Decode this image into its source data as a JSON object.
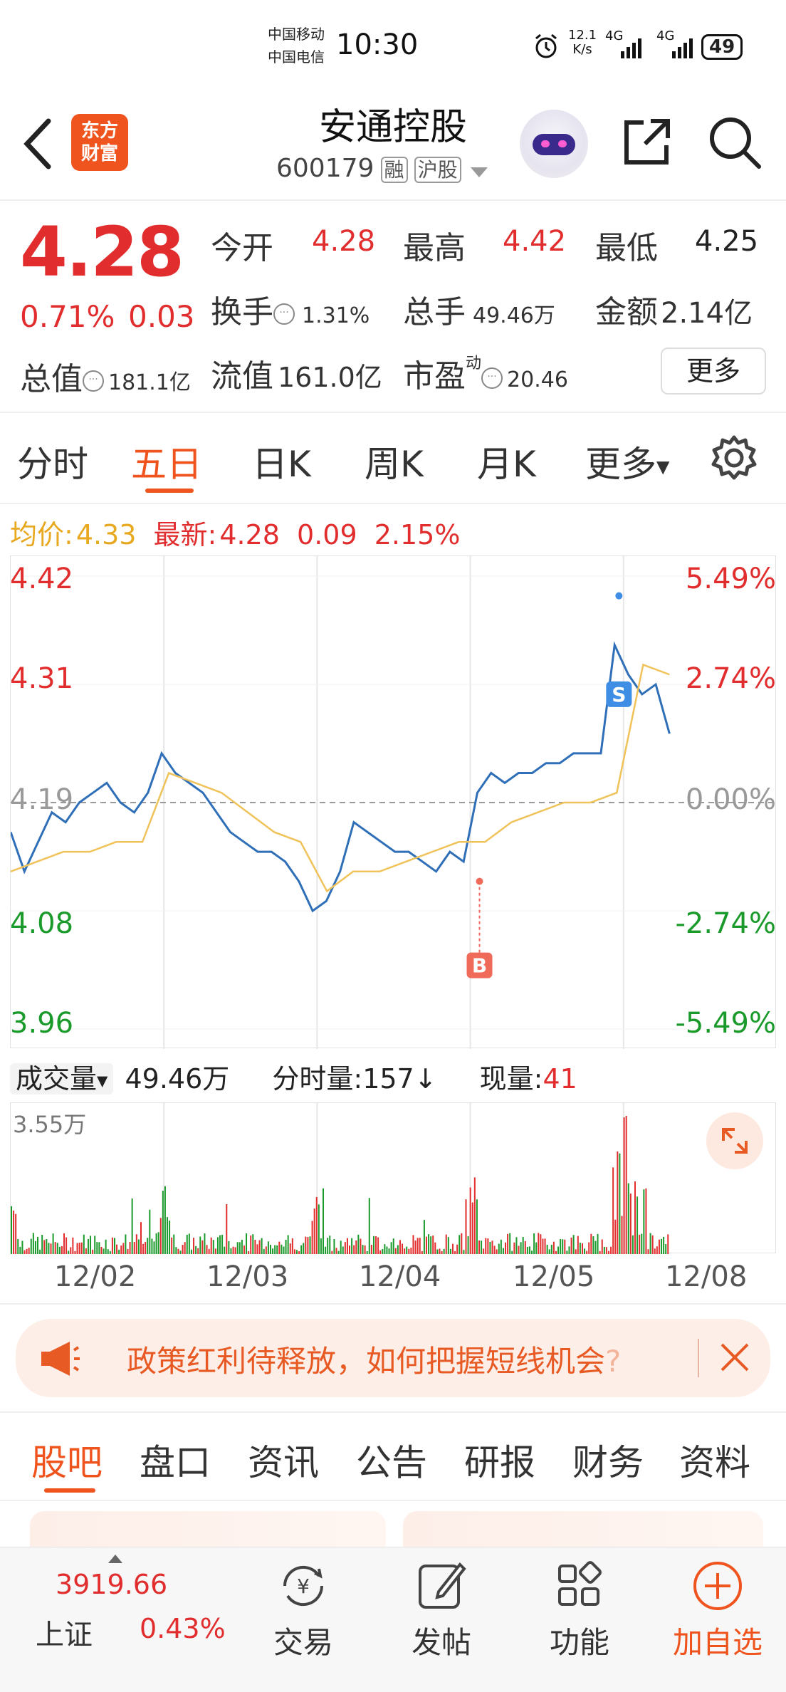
{
  "status_bar": {
    "carrier1": "中国移动",
    "carrier2": "中国电信",
    "time": "10:30",
    "net_speed_top": "12.1",
    "net_speed_unit": "K/s",
    "sig1": "4G",
    "sig2": "4G",
    "battery": "49"
  },
  "header": {
    "logo_line1": "东方",
    "logo_line2": "财富",
    "stock_name": "安通控股",
    "stock_code": "600179",
    "tag_margin": "融",
    "tag_market": "沪股"
  },
  "quote": {
    "price": "4.28",
    "change_pct": "0.71%",
    "change_abs": "0.03",
    "open_label": "今开",
    "open": "4.28",
    "high_label": "最高",
    "high": "4.42",
    "low_label": "最低",
    "low": "4.25",
    "turnover_label": "换手",
    "turnover": "1.31%",
    "volume_label": "总手",
    "volume": "49.46万",
    "amount_label": "金额",
    "amount": "2.14亿",
    "mcap_label": "总值",
    "mcap": "181.1亿",
    "float_label": "流值",
    "float": "161.0亿",
    "pe_label": "市盈",
    "pe_sup": "动",
    "pe": "20.46",
    "more": "更多"
  },
  "tabs": [
    "分时",
    "五日",
    "日K",
    "周K",
    "月K",
    "更多"
  ],
  "chart_info": {
    "avg_label": "均价:",
    "avg_value": "4.33",
    "latest_label": "最新:",
    "latest_value": "4.28",
    "latest_change": "0.09",
    "latest_pct": "2.15%"
  },
  "chart_data": {
    "type": "line",
    "left_axis": [
      "4.42",
      "4.31",
      "4.19",
      "4.08",
      "3.96"
    ],
    "right_axis": [
      "5.49%",
      "2.74%",
      "0.00%",
      "-2.74%",
      "-5.49%"
    ],
    "ylim": [
      3.96,
      4.42
    ],
    "reference": 4.19,
    "x": [
      "12/02",
      "12/03",
      "12/04",
      "12/05",
      "12/08"
    ],
    "series": [
      {
        "values": [
          4.16,
          4.12,
          4.15,
          4.18,
          4.17,
          4.19,
          4.2,
          4.21,
          4.19,
          4.18,
          4.2,
          4.24,
          4.22,
          4.21,
          4.2,
          4.18,
          4.16,
          4.15,
          4.14,
          4.14,
          4.13,
          4.11,
          4.08,
          4.09,
          4.12,
          4.17,
          4.16,
          4.15,
          4.14,
          4.14,
          4.13,
          4.12,
          4.14,
          4.13,
          4.2,
          4.22,
          4.21,
          4.22,
          4.22,
          4.23,
          4.23,
          4.24,
          4.24,
          4.24,
          4.35,
          4.32,
          4.3,
          4.31,
          4.26
        ]
      },
      {
        "values": [
          4.12,
          4.13,
          4.14,
          4.14,
          4.15,
          4.15,
          4.22,
          4.21,
          4.2,
          4.18,
          4.16,
          4.15,
          4.1,
          4.12,
          4.12,
          4.13,
          4.14,
          4.15,
          4.15,
          4.17,
          4.18,
          4.19,
          4.19,
          4.2,
          4.33,
          4.32
        ]
      }
    ],
    "markers": [
      {
        "label": "B",
        "value": 4.11
      },
      {
        "label": "S",
        "value": 4.3
      }
    ],
    "volume_max_label": "3.55万"
  },
  "volume_header": {
    "selector": "成交量",
    "total": "49.46万",
    "tick_label": "分时量:",
    "tick_value": "157",
    "tick_arrow": "↓",
    "now_label": "现量:",
    "now_value": "41"
  },
  "banner": {
    "text": "政策红利待释放，如何把握短线机会",
    "tail": "?"
  },
  "bottom_tabs": [
    "股吧",
    "盘口",
    "资讯",
    "公告",
    "研报",
    "财务",
    "资料"
  ],
  "bottom_nav": {
    "index_value": "3919.66",
    "index_name": "上证",
    "index_pct": "0.43%",
    "trade": "交易",
    "post": "发帖",
    "func": "功能",
    "add": "加自选"
  },
  "colors": {
    "accent": "#f0541e",
    "up": "#e12d2d",
    "down": "#1a9a2a",
    "line": "#2f6fb8",
    "avg": "#f0c35a"
  }
}
